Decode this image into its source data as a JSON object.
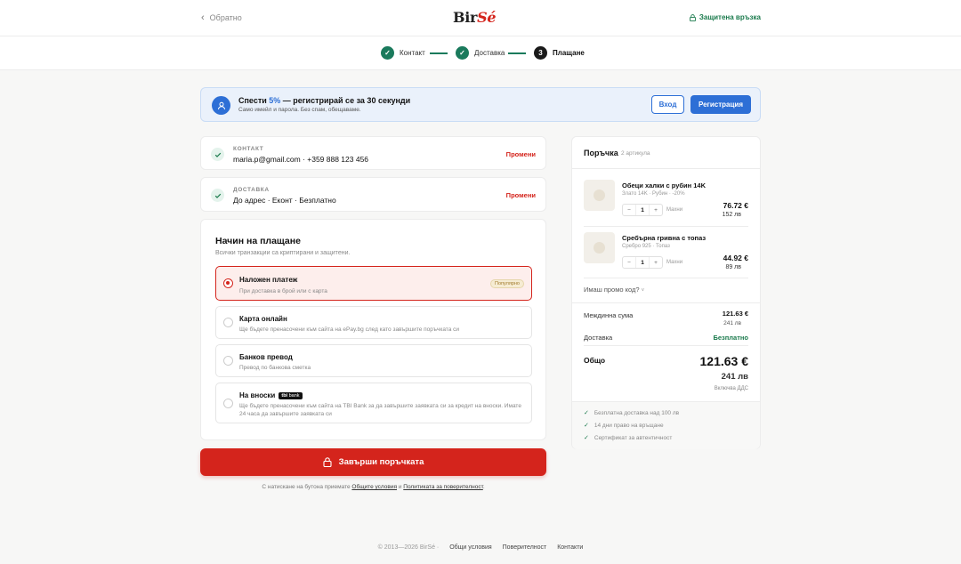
{
  "header": {
    "back_label": "Обратно",
    "logo_main": "Bir",
    "logo_accent": "Sé",
    "secure_label": "Защитена връзка"
  },
  "steps": [
    {
      "label": "Контакт",
      "state": "done"
    },
    {
      "label": "Доставка",
      "state": "done"
    },
    {
      "label": "Плащане",
      "state": "current",
      "number": "3"
    }
  ],
  "promo": {
    "title_pre": "Спести ",
    "title_pct": "5%",
    "title_post": " — регистрирай се за 30 секунди",
    "subtitle": "Само имейл и парола. Без спам, обещаваме.",
    "login_label": "Вход",
    "register_label": "Регистрация",
    "accent": "#2d6fd6"
  },
  "contact": {
    "label": "КОНТАКТ",
    "value": "maria.p@gmail.com · +359 888 123 456",
    "edit": "Промени"
  },
  "delivery": {
    "label": "ДОСТАВКА",
    "value": "До адрес · Еконт · Безплатно",
    "edit": "Промени"
  },
  "payment": {
    "title": "Начин на плащане",
    "subtitle": "Всички транзакции са криптирани и защитени.",
    "options": [
      {
        "name": "Наложен платеж",
        "desc": "При доставка в брой или с карта",
        "badge": "Популярно",
        "selected": true
      },
      {
        "name": "Карта онлайн",
        "desc": "Ще бъдете пренасочени към сайта на ePay.bg след като завършите поръчката си",
        "selected": false
      },
      {
        "name": "Банков превод",
        "desc": "Превод по банкова сметка",
        "selected": false
      },
      {
        "name": "На вноски",
        "badge_bold": "tbi",
        "badge_text": " bank",
        "desc": "Ще бъдете пренасочени към сайта на TBI Bank за да завършите заявката си за кредит на вноски. Имате 24 часа да завършите заявката си",
        "selected": false
      }
    ]
  },
  "cta": {
    "label": "Завърши поръчката",
    "color": "#d4241c"
  },
  "terms": {
    "pre": "С натискане на бутона приемате ",
    "link1": "Общите условия",
    "mid": " и ",
    "link2": "Политиката за поверителност",
    "post": "."
  },
  "order": {
    "title": "Поръчка",
    "count": "2 артикула",
    "items": [
      {
        "name": "Обеци халки с рубин 14K",
        "desc": "Злато 14K · Рубин · -20%",
        "qty": "1",
        "minus": "−",
        "plus": "+",
        "remove": "Махни",
        "price_eur": "76.72 €",
        "price_bgn": "152 лв"
      },
      {
        "name": "Сребърна гривна с топаз",
        "desc": "Сребро 925 · Топаз",
        "qty": "1",
        "minus": "−",
        "plus": "+",
        "remove": "Махни",
        "price_eur": "44.92 €",
        "price_bgn": "89 лв"
      }
    ],
    "promo_code": "Имаш промо код?",
    "promo_code_arrow": "˅",
    "subtotal_label": "Междинна сума",
    "subtotal_eur": "121.63 €",
    "subtotal_bgn": "241 лв",
    "shipping_label": "Доставка",
    "shipping_value": "Безплатно",
    "total_label": "Общо",
    "total_eur": "121.63 €",
    "total_bgn": "241 лв",
    "vat_note": "Включва ДДС",
    "perks": [
      "Безплатна доставка над 100 лв",
      "14 дни право на връщане",
      "Сертификат за автентичност"
    ]
  },
  "footer": {
    "copyright": "© 2013—2026 BirSé ·",
    "links": [
      "Общи условия",
      "Поверителност",
      "Контакти"
    ]
  }
}
